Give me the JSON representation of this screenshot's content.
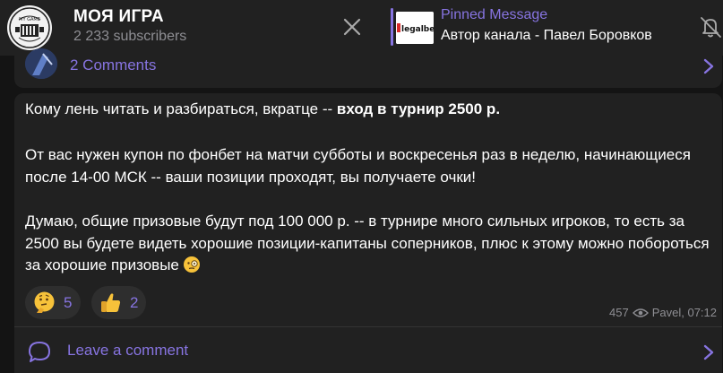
{
  "header": {
    "channel_title": "МОЯ ИГРА",
    "subscribers": "2 233 subscribers",
    "logo_text": "MY GAME",
    "pinned": {
      "title": "Pinned Message",
      "text": "Автор канала - Павел Боровков",
      "thumb_text": "legalbe"
    }
  },
  "prev_post": {
    "comments_label": "2 Comments"
  },
  "message": {
    "p1_text": "Кому лень читать и разбираться, вкратце -- ",
    "p1_bold": "вход в турнир 2500 р.",
    "p2": "От вас нужен купон по фонбет на матчи субботы и воскресенья раз в неделю, начинающиеся после 14-00 МСК -- ваши позиции проходят, вы получаете очки!",
    "p3": "Думаю, общие призовые будут под 100 000 р. -- в турнире много сильных игроков, то есть за 2500 вы будете видеть хорошие позиции-капитаны соперников, плюс к этому можно побороться за хорошие призовые",
    "reactions": [
      {
        "emoji": "thinking-face",
        "count": "5"
      },
      {
        "emoji": "thumbs-up",
        "count": "2"
      }
    ],
    "views": "457",
    "author_time": "Pavel, 07:12",
    "leave_comment": "Leave a comment"
  },
  "colors": {
    "accent": "#8774e1",
    "background": "#141414",
    "bubble": "#212121",
    "muted": "#8e8e93"
  }
}
